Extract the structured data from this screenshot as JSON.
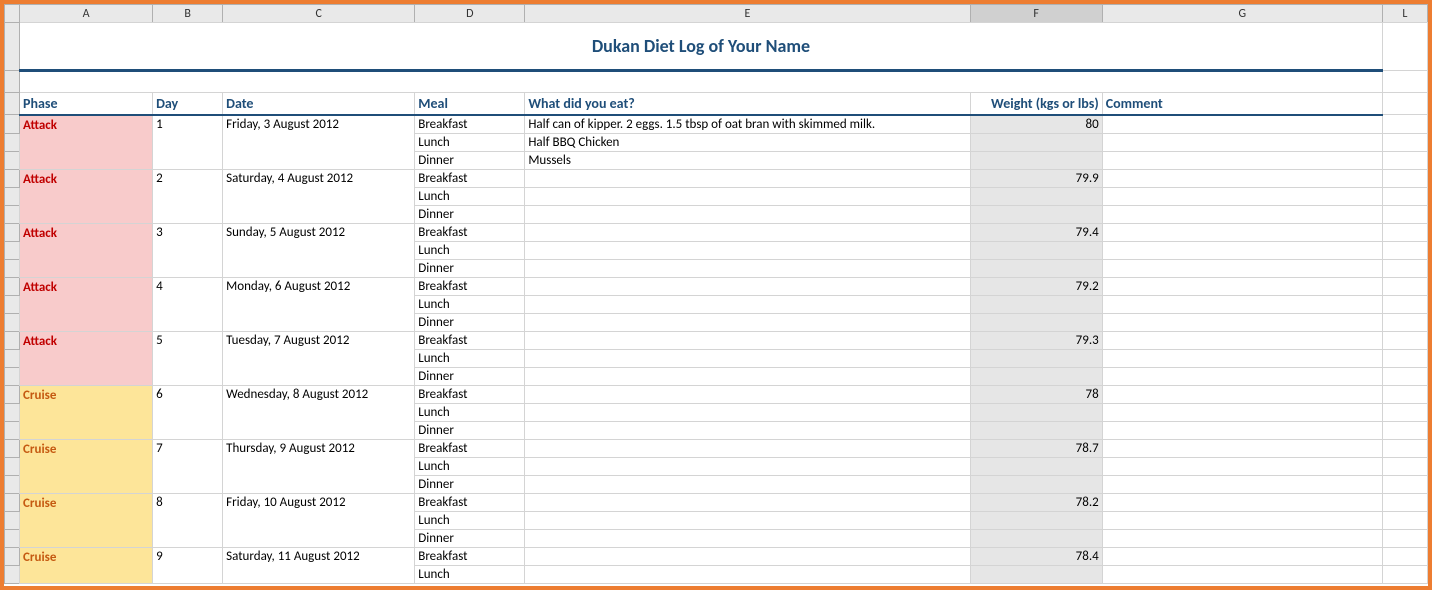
{
  "columns": {
    "A": "A",
    "B": "B",
    "C": "C",
    "D": "D",
    "E": "E",
    "F": "F",
    "G": "G",
    "L": "L"
  },
  "title": "Dukan Diet Log of Your Name",
  "headers": {
    "phase": "Phase",
    "day": "Day",
    "date": "Date",
    "meal": "Meal",
    "food": "What did you eat?",
    "weight": "Weight (kgs or lbs)",
    "comment": "Comment"
  },
  "meals": {
    "breakfast": "Breakfast",
    "lunch": "Lunch",
    "dinner": "Dinner"
  },
  "entries": [
    {
      "phase": "Attack",
      "phaseClass": "attack",
      "day": "1",
      "date": "Friday, 3 August 2012",
      "weight": "80",
      "food": {
        "breakfast": "Half can of kipper. 2 eggs. 1.5 tbsp of oat bran with skimmed milk.",
        "lunch": "Half BBQ Chicken",
        "dinner": "Mussels"
      }
    },
    {
      "phase": "Attack",
      "phaseClass": "attack",
      "day": "2",
      "date": "Saturday, 4 August 2012",
      "weight": "79.9",
      "food": {
        "breakfast": "",
        "lunch": "",
        "dinner": ""
      }
    },
    {
      "phase": "Attack",
      "phaseClass": "attack",
      "day": "3",
      "date": "Sunday, 5 August 2012",
      "weight": "79.4",
      "food": {
        "breakfast": "",
        "lunch": "",
        "dinner": ""
      }
    },
    {
      "phase": "Attack",
      "phaseClass": "attack",
      "day": "4",
      "date": "Monday, 6 August 2012",
      "weight": "79.2",
      "food": {
        "breakfast": "",
        "lunch": "",
        "dinner": ""
      }
    },
    {
      "phase": "Attack",
      "phaseClass": "attack",
      "day": "5",
      "date": "Tuesday, 7 August 2012",
      "weight": "79.3",
      "food": {
        "breakfast": "",
        "lunch": "",
        "dinner": ""
      }
    },
    {
      "phase": "Cruise",
      "phaseClass": "cruise",
      "day": "6",
      "date": "Wednesday, 8 August 2012",
      "weight": "78",
      "food": {
        "breakfast": "",
        "lunch": "",
        "dinner": ""
      }
    },
    {
      "phase": "Cruise",
      "phaseClass": "cruise",
      "day": "7",
      "date": "Thursday, 9 August 2012",
      "weight": "78.7",
      "food": {
        "breakfast": "",
        "lunch": "",
        "dinner": ""
      }
    },
    {
      "phase": "Cruise",
      "phaseClass": "cruise",
      "day": "8",
      "date": "Friday, 10 August 2012",
      "weight": "78.2",
      "food": {
        "breakfast": "",
        "lunch": "",
        "dinner": ""
      }
    },
    {
      "phase": "Cruise",
      "phaseClass": "cruise",
      "day": "9",
      "date": "Saturday, 11 August 2012",
      "weight": "78.4",
      "food": {
        "breakfast": "",
        "lunch": "",
        "dinner": ""
      }
    }
  ]
}
